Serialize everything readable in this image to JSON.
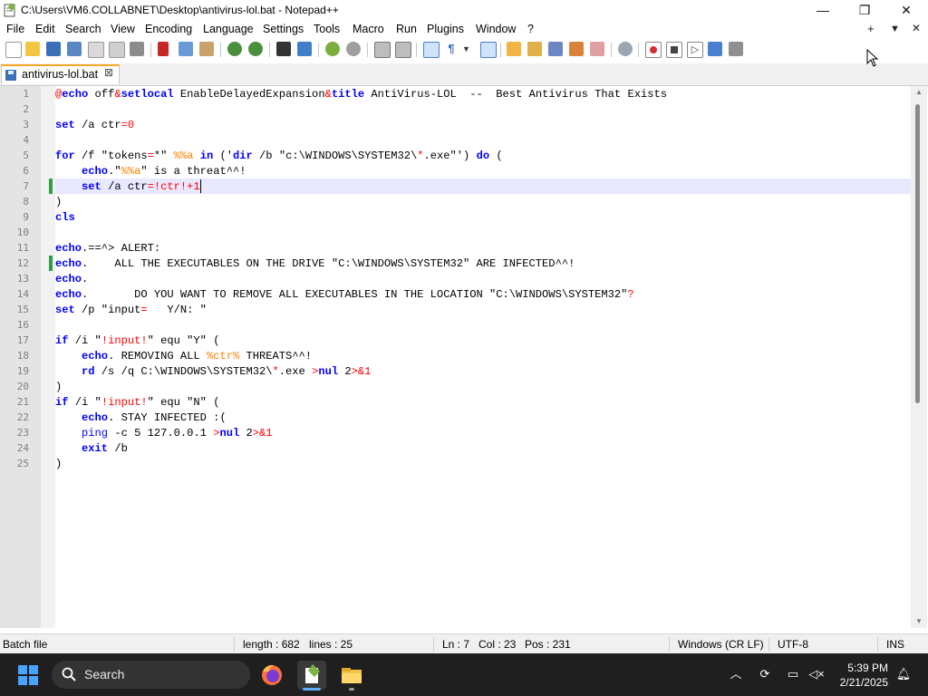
{
  "window": {
    "title": "C:\\Users\\VM6.COLLABNET\\Desktop\\antivirus-lol.bat - Notepad++",
    "minimize_glyph": "—",
    "maximize_glyph": "❐",
    "close_glyph": "✕"
  },
  "menu": {
    "items": [
      "File",
      "Edit",
      "Search",
      "View",
      "Encoding",
      "Language",
      "Settings",
      "Tools",
      "Macro",
      "Run",
      "Plugins",
      "Window",
      "?"
    ],
    "right": {
      "add": "+",
      "dropdown": "▼",
      "close": "✕"
    }
  },
  "toolbar": {
    "icons": [
      "new-file-icon",
      "open-file-icon",
      "save-icon",
      "save-all-icon",
      "close-icon",
      "close-all-icon",
      "print-icon",
      "cut-icon",
      "copy-icon",
      "paste-icon",
      "undo-icon",
      "redo-icon",
      "find-icon",
      "replace-icon",
      "zoom-in-icon",
      "zoom-out-icon",
      "sync-vertical-icon",
      "sync-horizontal-icon",
      "word-wrap-icon",
      "show-all-chars-icon",
      "indent-guide-icon",
      "lang-define-icon",
      "doc-map-icon",
      "function-list-icon",
      "folder-workspace-icon",
      "monitoring-icon",
      "macro-record-icon",
      "macro-stop-icon",
      "macro-play-icon",
      "macro-run-multiple-icon",
      "macro-save-icon"
    ]
  },
  "tab": {
    "label": "antivirus-lol.bat",
    "close": "⊠"
  },
  "editor": {
    "line_numbers": [
      "1",
      "2",
      "3",
      "4",
      "5",
      "6",
      "7",
      "8",
      "9",
      "10",
      "11",
      "12",
      "13",
      "14",
      "15",
      "16",
      "17",
      "18",
      "19",
      "20",
      "21",
      "22",
      "23",
      "24",
      "25"
    ],
    "current_line": 7
  },
  "status": {
    "language": "Batch file",
    "length": "length : 682",
    "lines": "lines : 25",
    "ln": "Ln : 7",
    "col": "Col : 23",
    "pos": "Pos : 231",
    "eol": "Windows (CR LF)",
    "encoding": "UTF-8",
    "mode": "INS"
  },
  "taskbar": {
    "search_placeholder": "Search",
    "time": "5:39 PM",
    "date": "2/21/2025",
    "tray_chevron": "︿"
  },
  "colors": {
    "keyword": "#0000ff",
    "operator": "#ff0000",
    "variable": "#ff8000",
    "current_line_bg": "#e8e8ff",
    "change_marker": "#2ea043",
    "taskbar_bg": "#1f1f1f"
  }
}
